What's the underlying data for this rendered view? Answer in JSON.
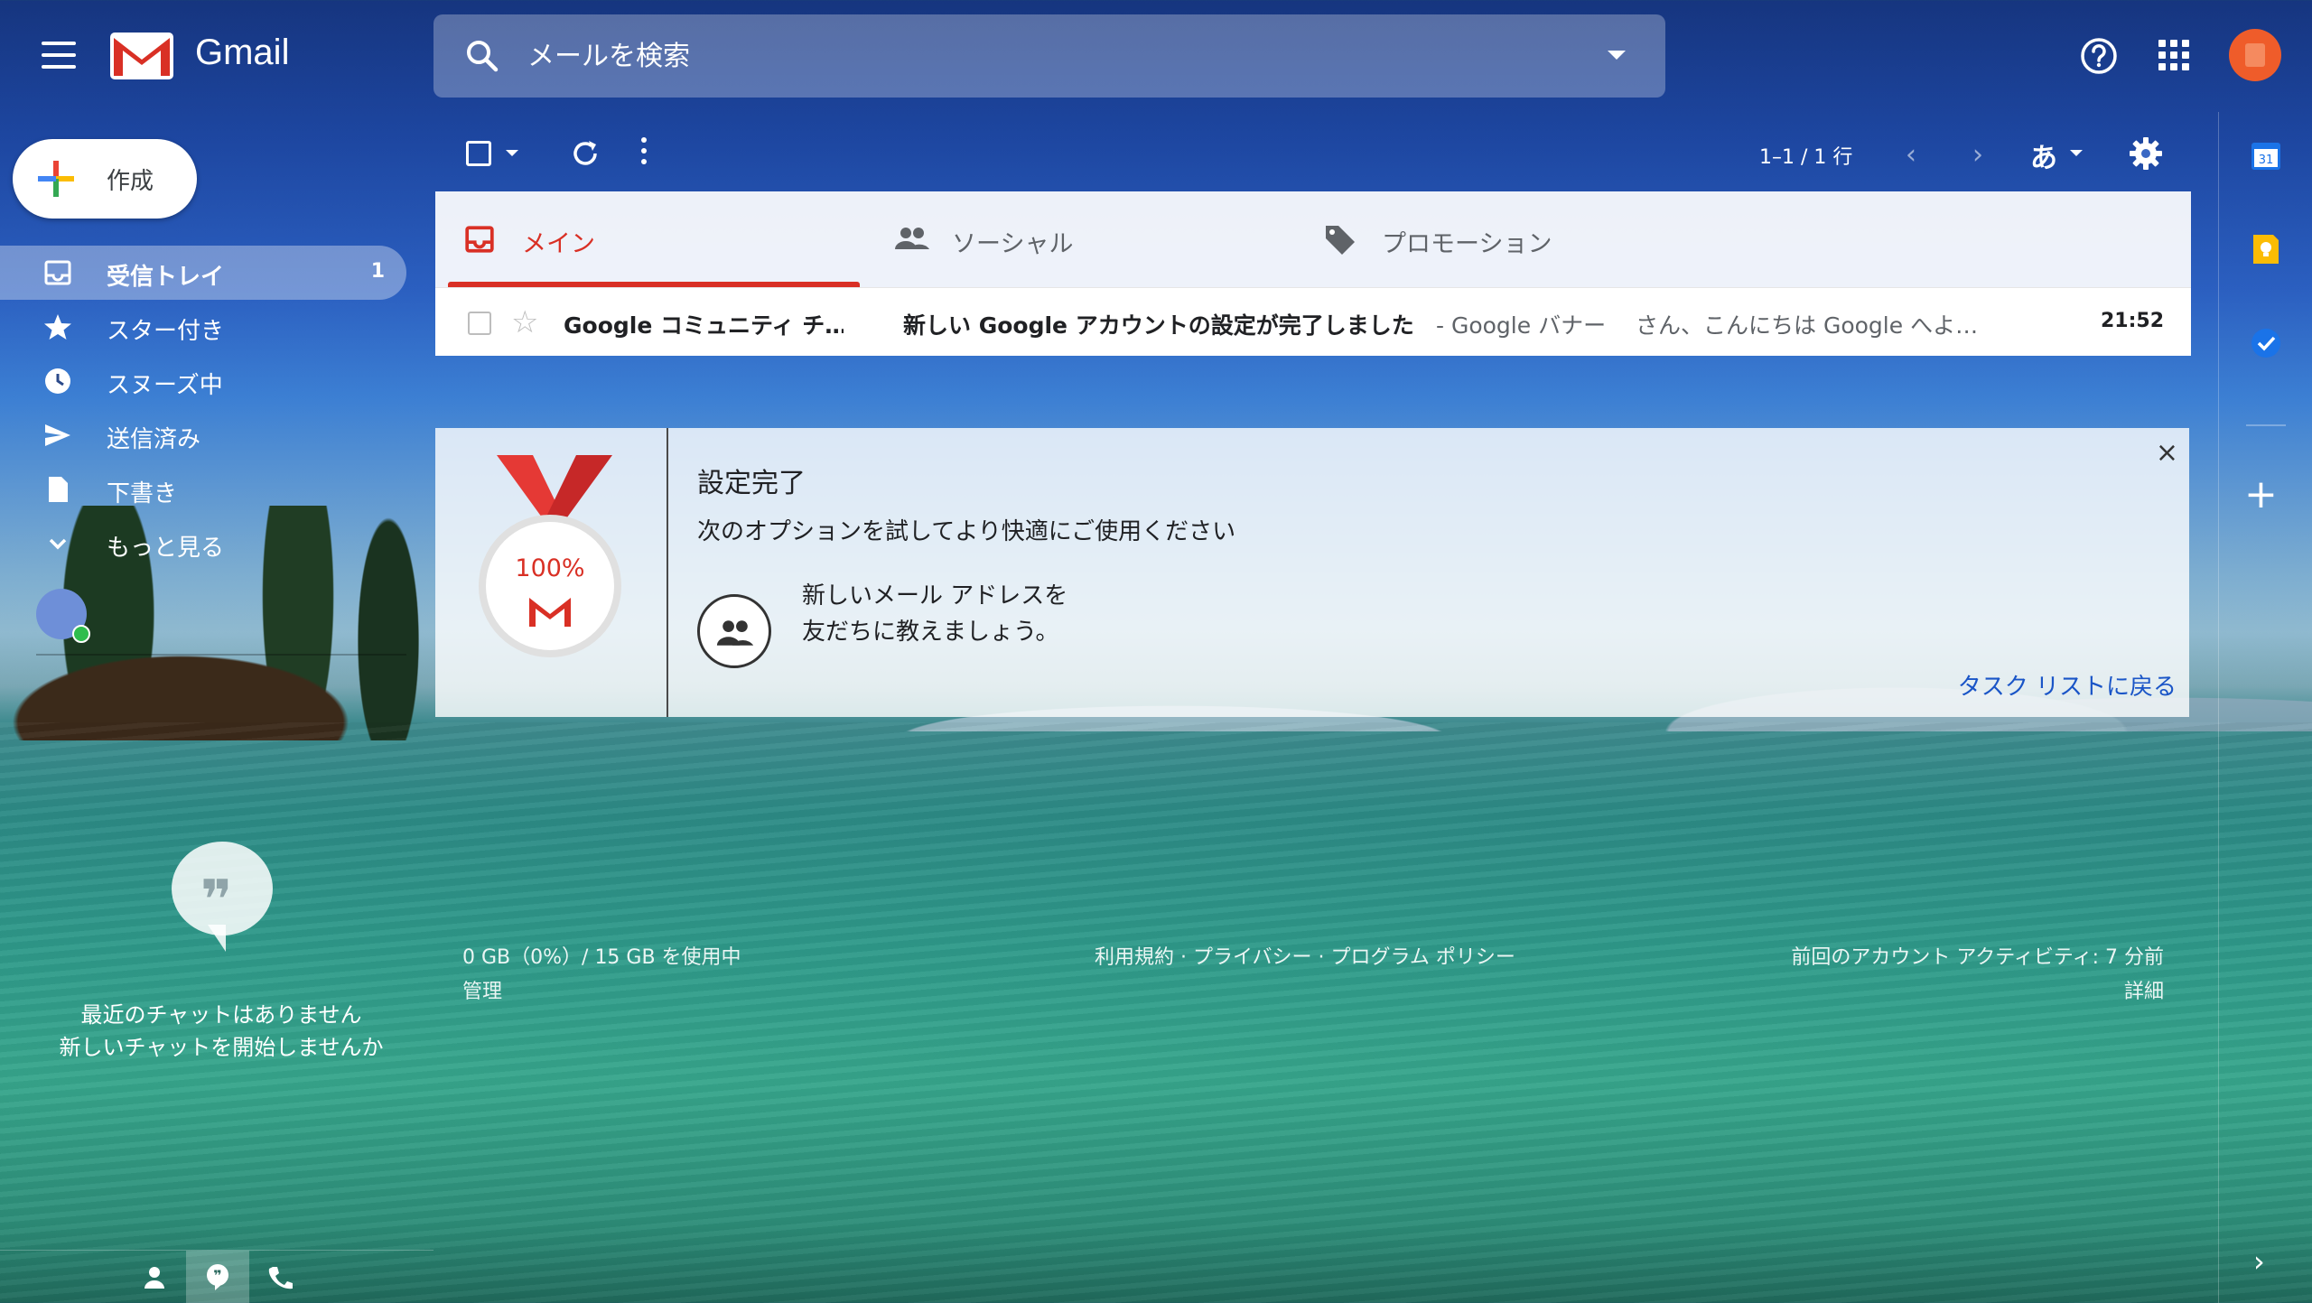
{
  "header": {
    "brand": "Gmail",
    "search_placeholder": "メールを検索"
  },
  "compose": {
    "label": "作成"
  },
  "nav": {
    "items": [
      {
        "label": "受信トレイ",
        "count": "1",
        "icon": "inbox-icon"
      },
      {
        "label": "スター付き",
        "icon": "star-icon"
      },
      {
        "label": "スヌーズ中",
        "icon": "clock-icon"
      },
      {
        "label": "送信済み",
        "icon": "send-icon"
      },
      {
        "label": "下書き",
        "icon": "draft-icon"
      },
      {
        "label": "もっと見る",
        "icon": "chevron-down-icon"
      }
    ]
  },
  "chat": {
    "empty_line1": "最近のチャットはありません",
    "empty_line2": "新しいチャットを開始しませんか"
  },
  "toolbar": {
    "pager": "1–1 / 1 行",
    "ime": "あ"
  },
  "tabs": [
    {
      "label": "メイン",
      "icon": "inbox-icon"
    },
    {
      "label": "ソーシャル",
      "icon": "people-icon"
    },
    {
      "label": "プロモーション",
      "icon": "tag-icon"
    }
  ],
  "mail": {
    "sender": "Google コミュニティ チ…",
    "subject": "新しい Google アカウントの設定が完了しました",
    "snippet": " - Google バナー　 さん、こんにちは Google へよ…",
    "time": "21:52"
  },
  "setup_card": {
    "progress": "100%",
    "progress_fraction": 1.0,
    "title": "設定完了",
    "subtitle": "次のオプションを試してより快適にご使用ください",
    "tile_text": "新しいメール アドレスを友だちに教えましょう。",
    "link": "タスク リストに戻る",
    "close": "×"
  },
  "footer": {
    "storage": "0 GB（0%）/ 15 GB を使用中",
    "manage": "管理",
    "links": "利用規約 · プライバシー · プログラム ポリシー",
    "activity": "前回のアカウント アクティビティ: 7 分前",
    "details": "詳細"
  },
  "colors": {
    "accent_red": "#d93025",
    "link_blue": "#1a55c7"
  }
}
